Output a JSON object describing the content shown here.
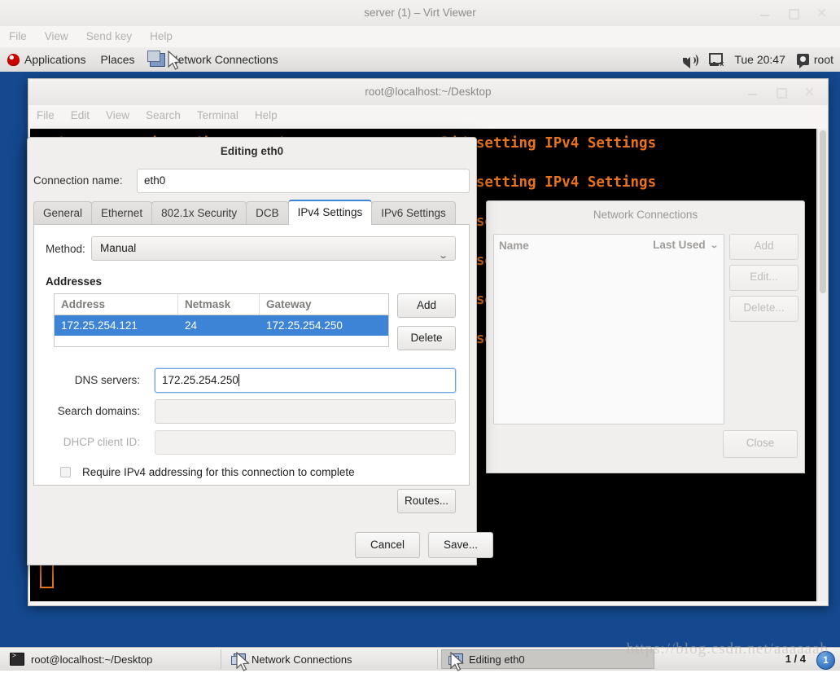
{
  "virt_viewer": {
    "title": "server (1) – Virt Viewer",
    "menu": [
      "File",
      "View",
      "Send key",
      "Help"
    ],
    "window_buttons": [
      "minimize-icon",
      "maximize-icon",
      "close-icon"
    ]
  },
  "gnome_panel": {
    "applications": "Applications",
    "places": "Places",
    "active_window": "Network Connections",
    "volume_icon": "volume-icon",
    "network_icon": "network-disconnected-icon",
    "clock": "Tue 20:47",
    "user": "root",
    "user_icon": "user-icon"
  },
  "terminal": {
    "title": "root@localhost:~/Desktop",
    "menu": [
      "File",
      "Edit",
      "View",
      "Search",
      "Terminal",
      "Help"
    ],
    "lines": [
      "** (nm-connection-editor:2260): WARNING **: Invalid setting IPv4 Settings",
      "** (nm-connection-editor:2260): WARNING **: Invalid setting IPv4 Settings",
      "** (nm-connection-editor:2260): WARNING **: Invalid setting IPv4 Settings",
      "** (nm-connection-editor:2260): WARNING **: Invalid setting IPv4 Settings",
      "** (nm-connection-editor:2260): WARNING **: Invalid setting IPv4 Settings",
      "** (nm-connection-editor:2260): WARNING **: Invalid setting IPv4 Settings"
    ],
    "text_color": "#e8731c",
    "background": "#000000"
  },
  "network_connections": {
    "title": "Network Connections",
    "columns": {
      "name": "Name",
      "last_used": "Last Used"
    },
    "sort_arrow": "chevron-down-icon",
    "rows": [],
    "buttons": {
      "add": "Add",
      "edit": "Edit...",
      "delete": "Delete...",
      "close": "Close"
    }
  },
  "editing_dialog": {
    "title": "Editing eth0",
    "connection_name_label": "Connection name:",
    "connection_name_value": "eth0",
    "tabs": [
      {
        "label": "General",
        "active": false
      },
      {
        "label": "Ethernet",
        "active": false
      },
      {
        "label": "802.1x Security",
        "active": false
      },
      {
        "label": "DCB",
        "active": false
      },
      {
        "label": "IPv4 Settings",
        "active": true
      },
      {
        "label": "IPv6 Settings",
        "active": false
      }
    ],
    "method_label": "Method:",
    "method_value": "Manual",
    "method_chevron": "chevron-down-icon",
    "addresses_label": "Addresses",
    "address_table": {
      "headers": [
        "Address",
        "Netmask",
        "Gateway"
      ],
      "rows": [
        {
          "address": "172.25.254.121",
          "netmask": "24",
          "gateway": "172.25.254.250",
          "selected": true
        }
      ],
      "selection_color": "#3d84d6"
    },
    "table_buttons": {
      "add": "Add",
      "delete": "Delete"
    },
    "dns_label": "DNS servers:",
    "dns_value": "172.25.254.250",
    "search_label": "Search domains:",
    "search_value": "",
    "dhcp_label": "DHCP client ID:",
    "dhcp_value": "",
    "require_checkbox_label": "Require IPv4 addressing for this connection to complete",
    "require_checkbox_checked": false,
    "routes_button": "Routes...",
    "cancel_button": "Cancel",
    "save_button": "Save..."
  },
  "taskbar": {
    "items": [
      {
        "label": "root@localhost:~/Desktop",
        "icon": "terminal-icon",
        "active": false
      },
      {
        "label": "Network Connections",
        "icon": "network-window-icon",
        "active": false
      },
      {
        "label": "Editing eth0",
        "icon": "network-window-icon",
        "active": true
      }
    ],
    "pager": "1 / 4",
    "badge": "1"
  },
  "watermark": "https://blog.csdn.net/aaaaaab"
}
